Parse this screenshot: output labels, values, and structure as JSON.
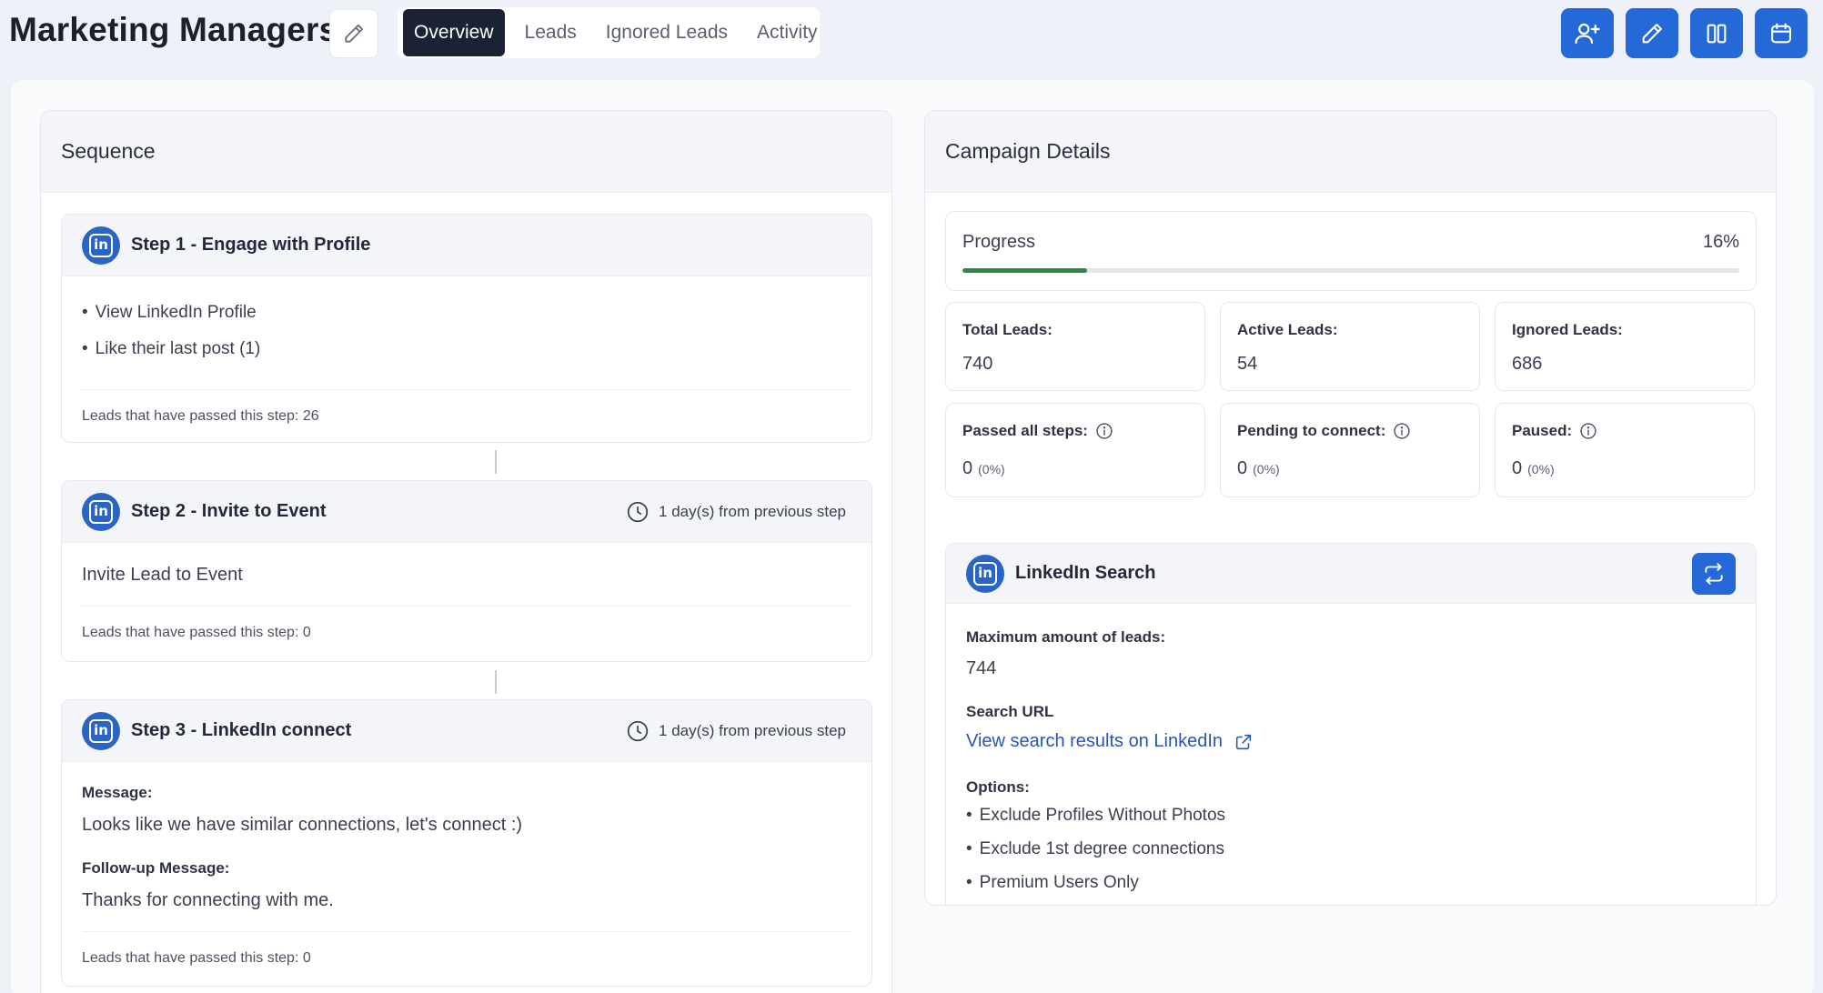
{
  "header": {
    "title": "Marketing Managers",
    "tabs": [
      {
        "label": "Overview",
        "active": true
      },
      {
        "label": "Leads",
        "active": false
      },
      {
        "label": "Ignored Leads",
        "active": false
      },
      {
        "label": "Activity",
        "active": false
      }
    ],
    "actions": [
      "add-user-icon",
      "pencil-icon",
      "columns-icon",
      "calendar-icon"
    ]
  },
  "sequence": {
    "title": "Sequence",
    "steps": [
      {
        "title": "Step 1 - Engage with Profile",
        "actions": [
          "View LinkedIn Profile",
          "Like their last post (1)"
        ],
        "passed": "Leads that have passed this step: 26"
      },
      {
        "title": "Step 2 - Invite to Event",
        "delay": "1 day(s) from previous step",
        "content": "Invite Lead to Event",
        "passed": "Leads that have passed this step: 0"
      },
      {
        "title": "Step 3 - LinkedIn connect",
        "delay": "1 day(s) from previous step",
        "message_label": "Message:",
        "message": "Looks like we have similar connections, let's connect :)",
        "followup_label": "Follow-up Message:",
        "followup": "Thanks for connecting with me.",
        "passed": "Leads that have passed this step: 0"
      }
    ]
  },
  "campaign": {
    "title": "Campaign Details",
    "progress": {
      "label": "Progress",
      "value_text": "16%",
      "value": 0.16
    },
    "stats": [
      {
        "label": "Total Leads:",
        "value": "740"
      },
      {
        "label": "Active Leads:",
        "value": "54"
      },
      {
        "label": "Ignored Leads:",
        "value": "686"
      },
      {
        "label": "Passed all steps:",
        "value": "0",
        "pct": "(0%)"
      },
      {
        "label": "Pending to connect:",
        "value": "0",
        "pct": "(0%)"
      },
      {
        "label": "Paused:",
        "value": "0",
        "pct": "(0%)"
      }
    ],
    "search": {
      "title": "LinkedIn Search",
      "max_label": "Maximum amount of leads:",
      "max_value": "744",
      "url_label": "Search URL",
      "url_link": "View search results on LinkedIn",
      "options_label": "Options:",
      "options": [
        "Exclude Profiles Without Photos",
        "Exclude 1st degree connections",
        "Premium Users Only"
      ]
    }
  },
  "colors": {
    "accent": "#2569d8",
    "progress": "#2b8a4a",
    "active_tab": "#1a2233",
    "linkedin": "#2a64c4"
  }
}
